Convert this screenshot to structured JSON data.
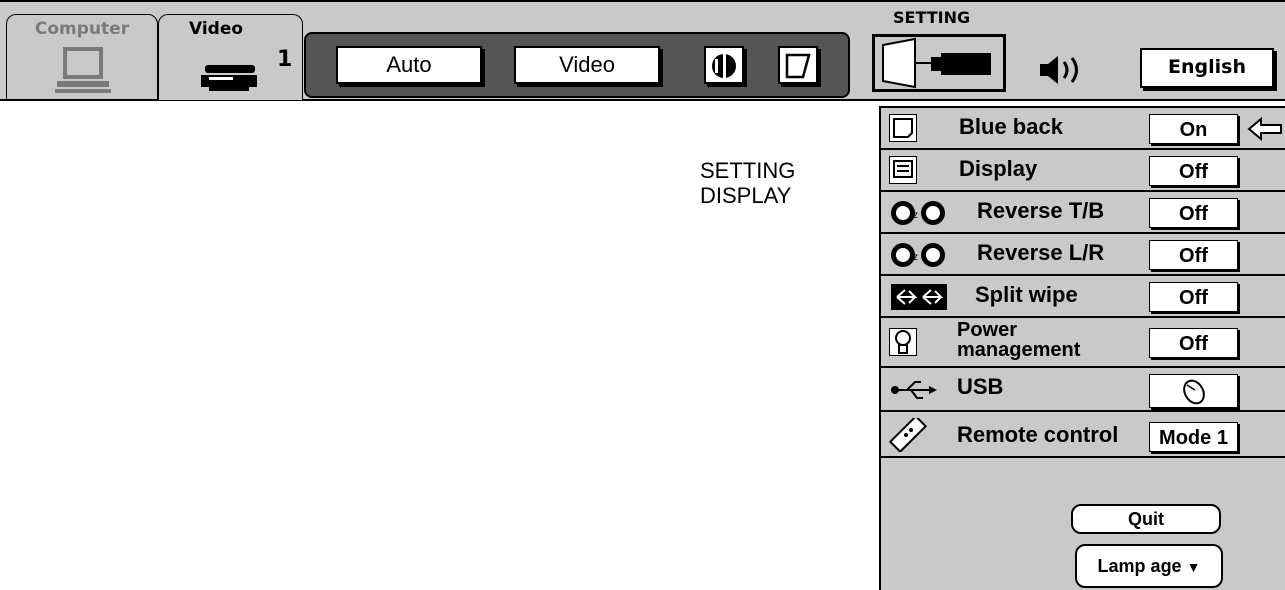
{
  "tabs": [
    {
      "label": "Computer"
    },
    {
      "label": "Video",
      "number": "1"
    }
  ],
  "toolbar": {
    "auto_label": "Auto",
    "video_label": "Video",
    "setting_title": "SETTING",
    "language_label": "English"
  },
  "caption": {
    "line1": "SETTING",
    "line2": "DISPLAY"
  },
  "menu": {
    "items": [
      {
        "label": "Blue back",
        "value": "On",
        "icon": "blue-back-icon"
      },
      {
        "label": "Display",
        "value": "Off",
        "icon": "display-icon"
      },
      {
        "label": "Reverse T/B",
        "value": "Off",
        "icon": "reverse-tb-icon"
      },
      {
        "label": "Reverse L/R",
        "value": "Off",
        "icon": "reverse-lr-icon"
      },
      {
        "label": "Split wipe",
        "value": "Off",
        "icon": "split-wipe-icon"
      },
      {
        "label": "Power",
        "label2": "management",
        "value": "Off",
        "icon": "power-management-icon"
      },
      {
        "label": "USB",
        "value": "",
        "icon": "usb-icon"
      },
      {
        "label": "Remote control",
        "value": "Mode 1",
        "icon": "remote-control-icon"
      }
    ],
    "quit_label": "Quit",
    "lamp_age_label": "Lamp age"
  }
}
